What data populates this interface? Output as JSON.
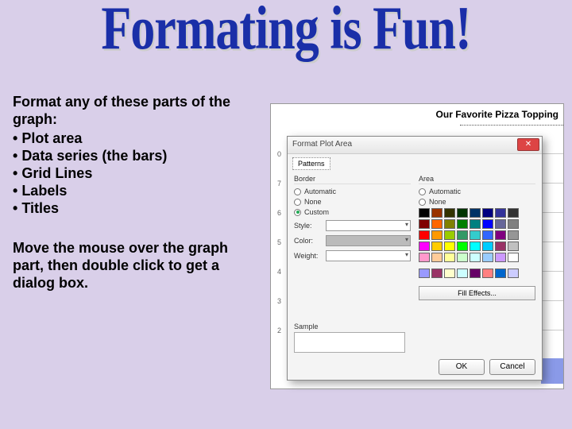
{
  "title": "Formating is Fun!",
  "left": {
    "intro": "Format any of these parts of the graph:",
    "bullets": [
      "Plot area",
      "Data series (the bars)",
      "Grid Lines",
      "Labels",
      "Titles"
    ],
    "para2a": "Move the mouse over the graph part, then double click to get a dialog box."
  },
  "chart": {
    "title": "Our Favorite Pizza Topping",
    "yticks": [
      "0",
      "7",
      "6",
      "5",
      "4",
      "3",
      "2"
    ]
  },
  "dialog": {
    "title": "Format Plot Area",
    "tab": "Patterns",
    "border": {
      "heading": "Border",
      "opt_auto": "Automatic",
      "opt_none": "None",
      "opt_custom": "Custom",
      "style": "Style:",
      "color": "Color:",
      "weight": "Weight:"
    },
    "area": {
      "heading": "Area",
      "opt_auto": "Automatic",
      "opt_none": "None",
      "fillfx": "Fill Effects..."
    },
    "sample": "Sample",
    "ok": "OK",
    "cancel": "Cancel"
  },
  "palette1": [
    "#000000",
    "#993300",
    "#333300",
    "#003300",
    "#003366",
    "#000080",
    "#333399",
    "#333333",
    "#800000",
    "#ff6600",
    "#808000",
    "#008000",
    "#008080",
    "#0000ff",
    "#666699",
    "#808080",
    "#ff0000",
    "#ff9900",
    "#99cc00",
    "#339966",
    "#33cccc",
    "#3366ff",
    "#800080",
    "#969696",
    "#ff00ff",
    "#ffcc00",
    "#ffff00",
    "#00ff00",
    "#00ffff",
    "#00ccff",
    "#993366",
    "#c0c0c0",
    "#ff99cc",
    "#ffcc99",
    "#ffff99",
    "#ccffcc",
    "#ccffff",
    "#99ccff",
    "#cc99ff",
    "#ffffff"
  ],
  "palette2": [
    "#9999ff",
    "#993366",
    "#ffffcc",
    "#ccffff",
    "#660066",
    "#ff8080",
    "#0066cc",
    "#ccccff"
  ]
}
